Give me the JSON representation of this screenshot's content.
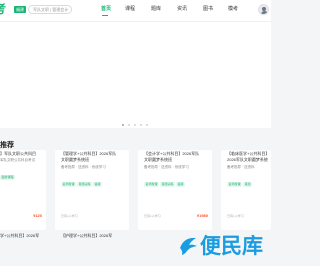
{
  "header": {
    "logo_text": "考",
    "city_tag": "福建",
    "search_placeholder": "军队文职 | 管理会计",
    "nav": [
      {
        "label": "首页",
        "active": true
      },
      {
        "label": "课程",
        "active": false
      },
      {
        "label": "题库",
        "active": false
      },
      {
        "label": "资讯",
        "active": false
      },
      {
        "label": "图书",
        "active": false
      },
      {
        "label": "模考",
        "active": false
      }
    ],
    "accent_color": "#15b374"
  },
  "banner": {
    "slide_count": 5,
    "active_slide": 0
  },
  "section": {
    "title": "推荐"
  },
  "cards": [
    {
      "title": "】军队文职公共科目",
      "subtitle": "军队文职公共科目考试",
      "tags": [
        "面授课程"
      ],
      "meta": "",
      "price": "¥120"
    },
    {
      "title": "【管理学+公共科目】2026军队文职圆梦系统班",
      "subtitle": "备考指导  · 送资料  · 系统学习",
      "tags": [
        "名师授课",
        "真题演练",
        "答疑"
      ],
      "meta": "已有1人学习",
      "price": ""
    },
    {
      "title": "【会计学+公共科目】2026军队文职圆梦系统班",
      "subtitle": "备考指导  · 送资料  · 系统学习",
      "tags": [
        "名师授课",
        "真题演练",
        "答疑"
      ],
      "meta": "已有1人学习",
      "price": "¥1980"
    },
    {
      "title": "【临床医学+公共科目】2026军队文职圆梦系统",
      "subtitle": "备考指导  · 送资料",
      "tags": [
        "名师授课",
        "真题"
      ],
      "meta": "已有1人学习",
      "price": ""
    }
  ],
  "row2": [
    {
      "title": "学+公共科目】2026军"
    },
    {
      "title": "【护理学+公共科目】2026军"
    }
  ],
  "watermark": {
    "text": "便民库",
    "color": "#1a9de0"
  }
}
